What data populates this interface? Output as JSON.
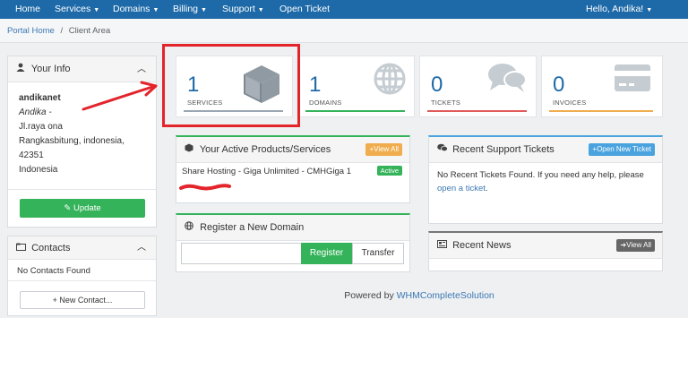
{
  "nav": {
    "home": "Home",
    "services": "Services",
    "domains": "Domains",
    "billing": "Billing",
    "support": "Support",
    "open_ticket": "Open Ticket",
    "user": "Hello, Andika!"
  },
  "breadcrumb": {
    "home": "Portal Home",
    "sep": "/",
    "current": "Client Area"
  },
  "your_info": {
    "title": "Your Info",
    "username": "andikanet",
    "name": "Andika -",
    "address1": "Jl.raya ona",
    "city_line": "Rangkasbitung, indonesia,",
    "postcode": "42351",
    "country": "Indonesia",
    "update_button": "Update"
  },
  "contacts": {
    "title": "Contacts",
    "empty": "No Contacts Found",
    "new_button": "+ New Contact..."
  },
  "stats": [
    {
      "value": "1",
      "label": "SERVICES",
      "icon": "cube-icon",
      "color": "#9aa6b1"
    },
    {
      "value": "1",
      "label": "DOMAINS",
      "icon": "globe-icon",
      "color": "#35b35a"
    },
    {
      "value": "0",
      "label": "TICKETS",
      "icon": "comments-icon",
      "color": "#e05a5a"
    },
    {
      "value": "0",
      "label": "INVOICES",
      "icon": "credit-card-icon",
      "color": "#f0ad4e"
    }
  ],
  "products": {
    "title": "Your Active Products/Services",
    "view_all": "View All",
    "item_name": "Share Hosting - Giga Unlimited - CMHGiga 1",
    "item_status": "Active"
  },
  "register_domain": {
    "title": "Register a New Domain",
    "register": "Register",
    "transfer": "Transfer",
    "input_value": ""
  },
  "tickets": {
    "title": "Recent Support Tickets",
    "new_button": "Open New Ticket",
    "empty_text": "No Recent Tickets Found. If you need any help, please",
    "link": "open a ticket",
    "link_suffix": "."
  },
  "news": {
    "title": "Recent News",
    "view_all": "View All"
  },
  "footer": {
    "prefix": "Powered by ",
    "link": "WHMCompleteSolution"
  },
  "colors": {
    "nav": "#1e6aa8",
    "green": "#35b35a",
    "annotation": "#e3242b"
  }
}
